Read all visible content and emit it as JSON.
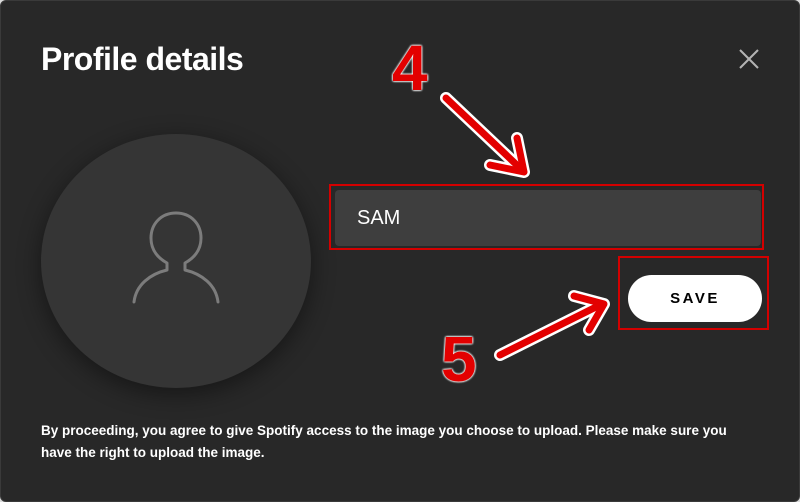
{
  "dialog": {
    "title": "Profile details",
    "close_icon": "close-icon",
    "avatar_icon": "user-silhouette-icon",
    "name_value": "SAM",
    "save_label": "SAVE",
    "disclaimer": "By proceeding, you agree to give Spotify access to the image you choose to upload. Please make sure you have the right to upload the image."
  },
  "annotations": {
    "step_input": "4",
    "step_save": "5",
    "highlight_color": "#e30000"
  },
  "colors": {
    "dialog_background": "#282828",
    "avatar_background": "#353535",
    "input_background": "#3e3e3e",
    "button_background": "#ffffff"
  }
}
